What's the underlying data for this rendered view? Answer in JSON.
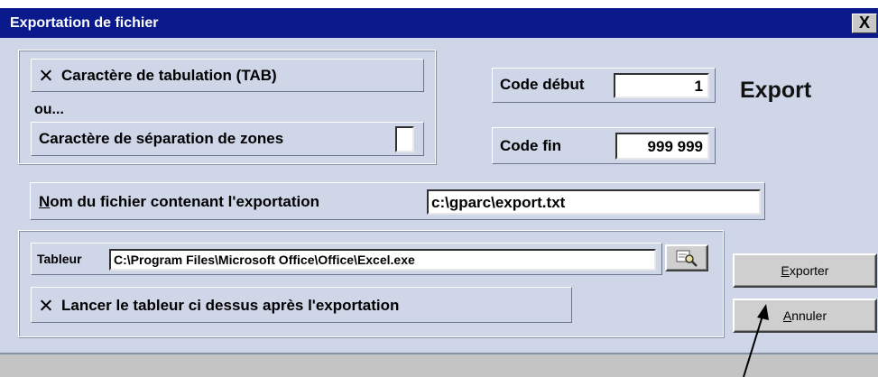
{
  "window": {
    "title": "Exportation de fichier",
    "close_label": "X"
  },
  "separator": {
    "tab_checkbox_checked": true,
    "tab_label": "Caractère de tabulation (TAB)",
    "or_label": "ou...",
    "sep_label": "Caractère de séparation de zones",
    "sep_value": ""
  },
  "codes": {
    "start_label": "Code début",
    "start_value": "1",
    "end_label": "Code fin",
    "end_value": "999 999",
    "export_heading": "Export"
  },
  "file": {
    "label_accel": "N",
    "label_rest": "om du fichier contenant l'exportation",
    "value": "c:\\gparc\\export.txt"
  },
  "spreadsheet": {
    "label": "Tableur",
    "path": "C:\\Program Files\\Microsoft Office\\Office\\Excel.exe",
    "browse_icon": "magnifier-icon",
    "launch_checked": true,
    "launch_label": "Lancer le tableur ci dessus après l'exportation"
  },
  "buttons": {
    "export_accel": "E",
    "export_rest": "xporter",
    "cancel_accel": "A",
    "cancel_rest": "nnuler"
  },
  "colors": {
    "titlebar": "#0a1a8c",
    "background": "#ced6e8"
  }
}
